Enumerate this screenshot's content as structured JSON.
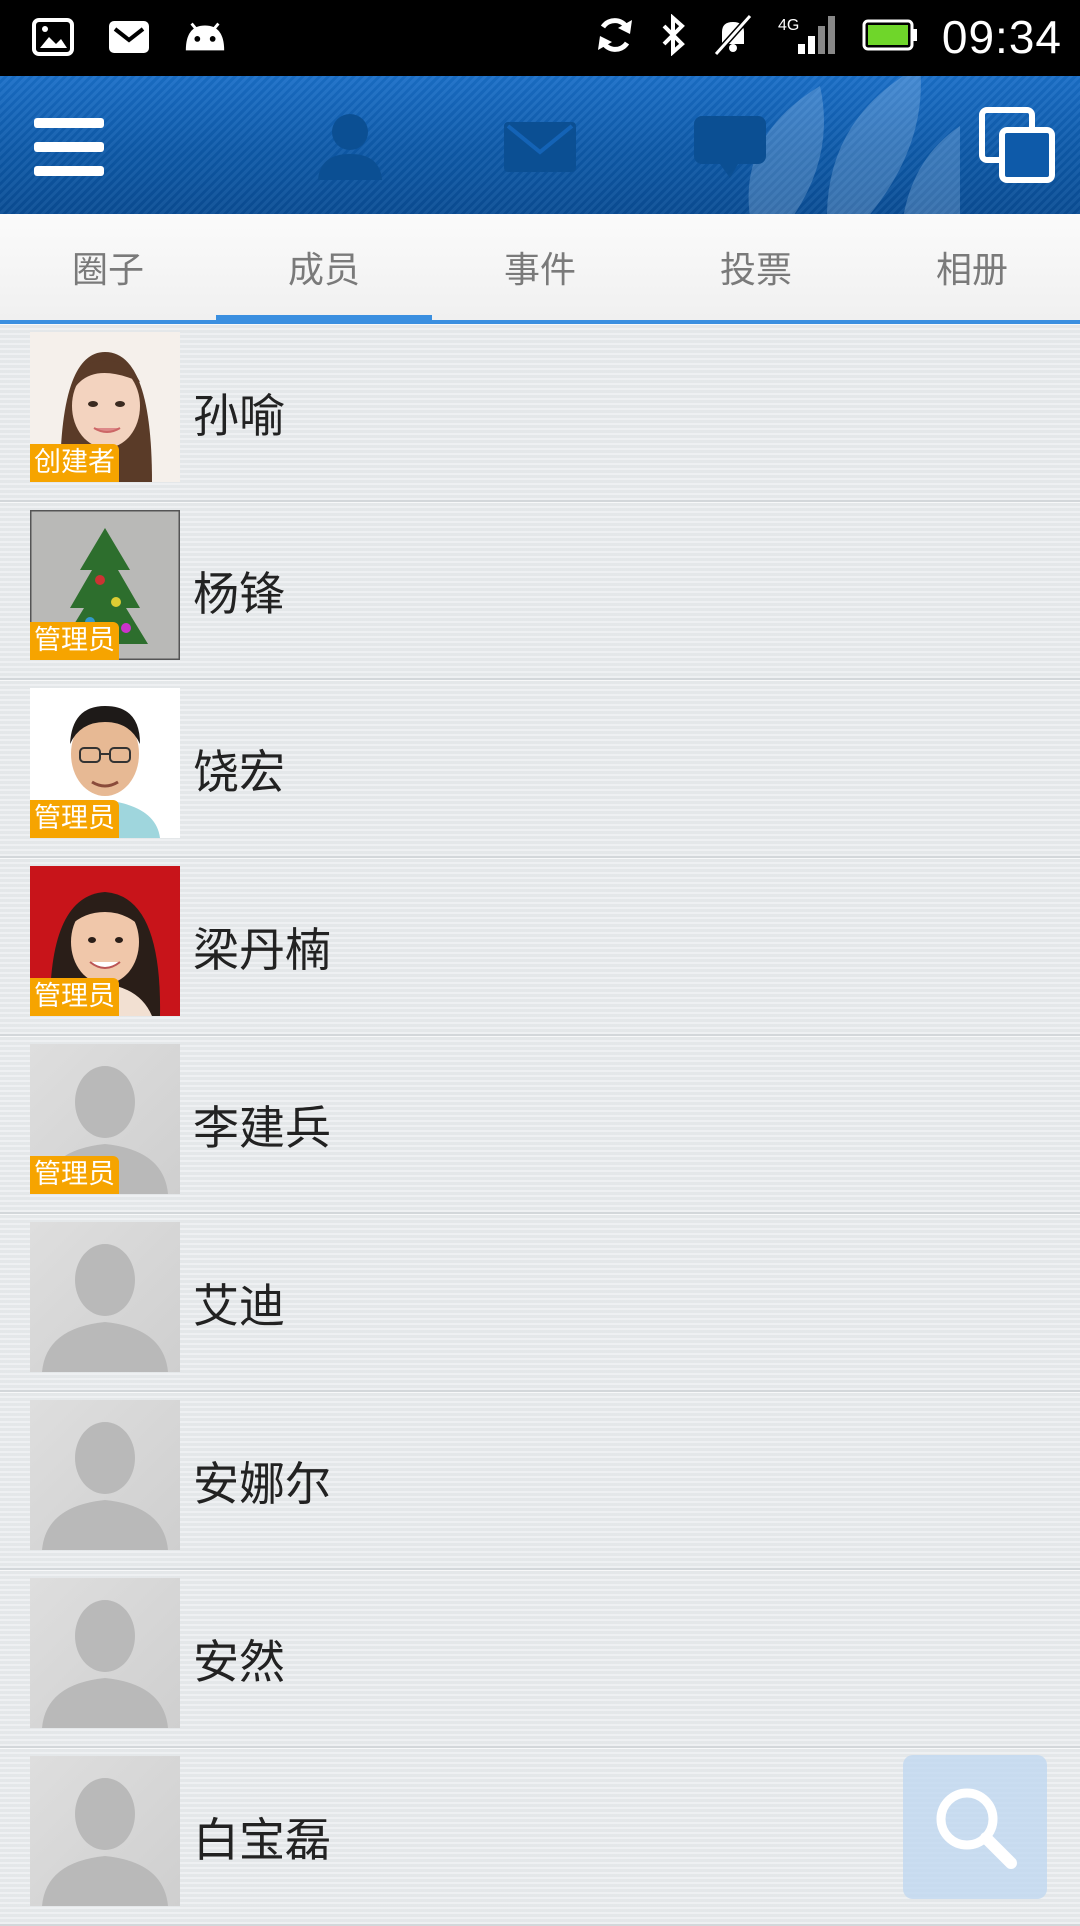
{
  "status_bar": {
    "time": "09:34",
    "network": "4G",
    "left_icons": [
      "gallery-icon",
      "mail-icon",
      "android-icon"
    ],
    "right_icons": [
      "sync-icon",
      "bluetooth-icon",
      "mute-icon",
      "signal-icon",
      "battery-icon"
    ]
  },
  "app_bar": {
    "icons": [
      "menu-icon",
      "contacts-icon",
      "mail-icon",
      "chat-icon",
      "window-switch-icon"
    ],
    "accent": "#0e5aa9"
  },
  "tabs": [
    {
      "label": "圈子",
      "active": false
    },
    {
      "label": "成员",
      "active": true
    },
    {
      "label": "事件",
      "active": false
    },
    {
      "label": "投票",
      "active": false
    },
    {
      "label": "相册",
      "active": false
    }
  ],
  "members": [
    {
      "name": "孙喻",
      "role": "创建者",
      "avatar": "woman-photo"
    },
    {
      "name": "杨锋",
      "role": "管理员",
      "avatar": "christmas-tree-photo"
    },
    {
      "name": "饶宏",
      "role": "管理员",
      "avatar": "man-glasses-photo"
    },
    {
      "name": "梁丹楠",
      "role": "管理员",
      "avatar": "woman-red-bg-photo"
    },
    {
      "name": "李建兵",
      "role": "管理员",
      "avatar": "default-avatar"
    },
    {
      "name": "艾迪",
      "role": "",
      "avatar": "default-avatar"
    },
    {
      "name": "安娜尔",
      "role": "",
      "avatar": "default-avatar"
    },
    {
      "name": "安然",
      "role": "",
      "avatar": "default-avatar"
    },
    {
      "name": "白宝磊",
      "role": "",
      "avatar": "default-avatar"
    }
  ],
  "colors": {
    "badge": "#f6a400",
    "tab_indicator": "#3a8fe0"
  }
}
